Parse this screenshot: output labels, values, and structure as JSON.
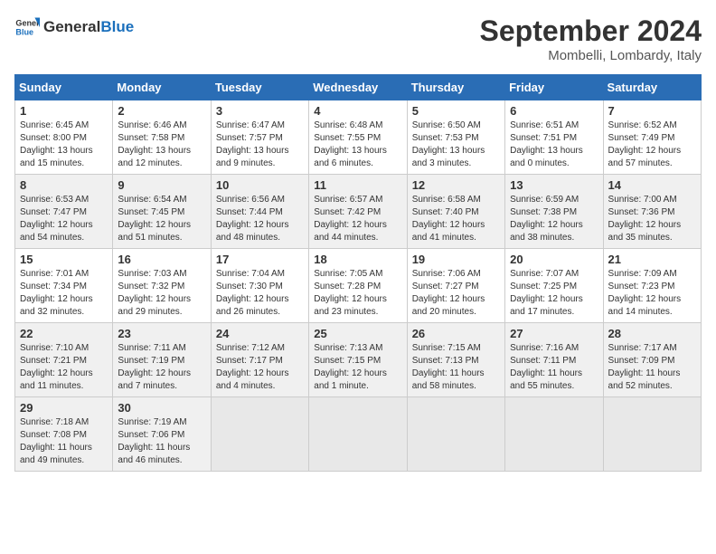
{
  "header": {
    "logo_general": "General",
    "logo_blue": "Blue",
    "title": "September 2024",
    "subtitle": "Mombelli, Lombardy, Italy"
  },
  "calendar": {
    "days_of_week": [
      "Sunday",
      "Monday",
      "Tuesday",
      "Wednesday",
      "Thursday",
      "Friday",
      "Saturday"
    ],
    "weeks": [
      [
        {
          "day": "",
          "empty": true
        },
        {
          "day": "2",
          "info": "Sunrise: 6:46 AM\nSunset: 7:58 PM\nDaylight: 13 hours\nand 12 minutes."
        },
        {
          "day": "3",
          "info": "Sunrise: 6:47 AM\nSunset: 7:57 PM\nDaylight: 13 hours\nand 9 minutes."
        },
        {
          "day": "4",
          "info": "Sunrise: 6:48 AM\nSunset: 7:55 PM\nDaylight: 13 hours\nand 6 minutes."
        },
        {
          "day": "5",
          "info": "Sunrise: 6:50 AM\nSunset: 7:53 PM\nDaylight: 13 hours\nand 3 minutes."
        },
        {
          "day": "6",
          "info": "Sunrise: 6:51 AM\nSunset: 7:51 PM\nDaylight: 13 hours\nand 0 minutes."
        },
        {
          "day": "7",
          "info": "Sunrise: 6:52 AM\nSunset: 7:49 PM\nDaylight: 12 hours\nand 57 minutes."
        }
      ],
      [
        {
          "day": "1",
          "info": "Sunrise: 6:45 AM\nSunset: 8:00 PM\nDaylight: 13 hours\nand 15 minutes."
        },
        {
          "day": "9",
          "info": "Sunrise: 6:54 AM\nSunset: 7:45 PM\nDaylight: 12 hours\nand 51 minutes."
        },
        {
          "day": "10",
          "info": "Sunrise: 6:56 AM\nSunset: 7:44 PM\nDaylight: 12 hours\nand 48 minutes."
        },
        {
          "day": "11",
          "info": "Sunrise: 6:57 AM\nSunset: 7:42 PM\nDaylight: 12 hours\nand 44 minutes."
        },
        {
          "day": "12",
          "info": "Sunrise: 6:58 AM\nSunset: 7:40 PM\nDaylight: 12 hours\nand 41 minutes."
        },
        {
          "day": "13",
          "info": "Sunrise: 6:59 AM\nSunset: 7:38 PM\nDaylight: 12 hours\nand 38 minutes."
        },
        {
          "day": "14",
          "info": "Sunrise: 7:00 AM\nSunset: 7:36 PM\nDaylight: 12 hours\nand 35 minutes."
        }
      ],
      [
        {
          "day": "8",
          "info": "Sunrise: 6:53 AM\nSunset: 7:47 PM\nDaylight: 12 hours\nand 54 minutes."
        },
        {
          "day": "16",
          "info": "Sunrise: 7:03 AM\nSunset: 7:32 PM\nDaylight: 12 hours\nand 29 minutes."
        },
        {
          "day": "17",
          "info": "Sunrise: 7:04 AM\nSunset: 7:30 PM\nDaylight: 12 hours\nand 26 minutes."
        },
        {
          "day": "18",
          "info": "Sunrise: 7:05 AM\nSunset: 7:28 PM\nDaylight: 12 hours\nand 23 minutes."
        },
        {
          "day": "19",
          "info": "Sunrise: 7:06 AM\nSunset: 7:27 PM\nDaylight: 12 hours\nand 20 minutes."
        },
        {
          "day": "20",
          "info": "Sunrise: 7:07 AM\nSunset: 7:25 PM\nDaylight: 12 hours\nand 17 minutes."
        },
        {
          "day": "21",
          "info": "Sunrise: 7:09 AM\nSunset: 7:23 PM\nDaylight: 12 hours\nand 14 minutes."
        }
      ],
      [
        {
          "day": "15",
          "info": "Sunrise: 7:01 AM\nSunset: 7:34 PM\nDaylight: 12 hours\nand 32 minutes."
        },
        {
          "day": "23",
          "info": "Sunrise: 7:11 AM\nSunset: 7:19 PM\nDaylight: 12 hours\nand 7 minutes."
        },
        {
          "day": "24",
          "info": "Sunrise: 7:12 AM\nSunset: 7:17 PM\nDaylight: 12 hours\nand 4 minutes."
        },
        {
          "day": "25",
          "info": "Sunrise: 7:13 AM\nSunset: 7:15 PM\nDaylight: 12 hours\nand 1 minute."
        },
        {
          "day": "26",
          "info": "Sunrise: 7:15 AM\nSunset: 7:13 PM\nDaylight: 11 hours\nand 58 minutes."
        },
        {
          "day": "27",
          "info": "Sunrise: 7:16 AM\nSunset: 7:11 PM\nDaylight: 11 hours\nand 55 minutes."
        },
        {
          "day": "28",
          "info": "Sunrise: 7:17 AM\nSunset: 7:09 PM\nDaylight: 11 hours\nand 52 minutes."
        }
      ],
      [
        {
          "day": "22",
          "info": "Sunrise: 7:10 AM\nSunset: 7:21 PM\nDaylight: 12 hours\nand 11 minutes."
        },
        {
          "day": "30",
          "info": "Sunrise: 7:19 AM\nSunset: 7:06 PM\nDaylight: 11 hours\nand 46 minutes."
        },
        {
          "day": "",
          "empty": true
        },
        {
          "day": "",
          "empty": true
        },
        {
          "day": "",
          "empty": true
        },
        {
          "day": "",
          "empty": true
        },
        {
          "day": "",
          "empty": true
        }
      ],
      [
        {
          "day": "29",
          "info": "Sunrise: 7:18 AM\nSunset: 7:08 PM\nDaylight: 11 hours\nand 49 minutes."
        },
        {
          "day": "",
          "empty": true
        },
        {
          "day": "",
          "empty": true
        },
        {
          "day": "",
          "empty": true
        },
        {
          "day": "",
          "empty": true
        },
        {
          "day": "",
          "empty": true
        },
        {
          "day": "",
          "empty": true
        }
      ]
    ]
  }
}
